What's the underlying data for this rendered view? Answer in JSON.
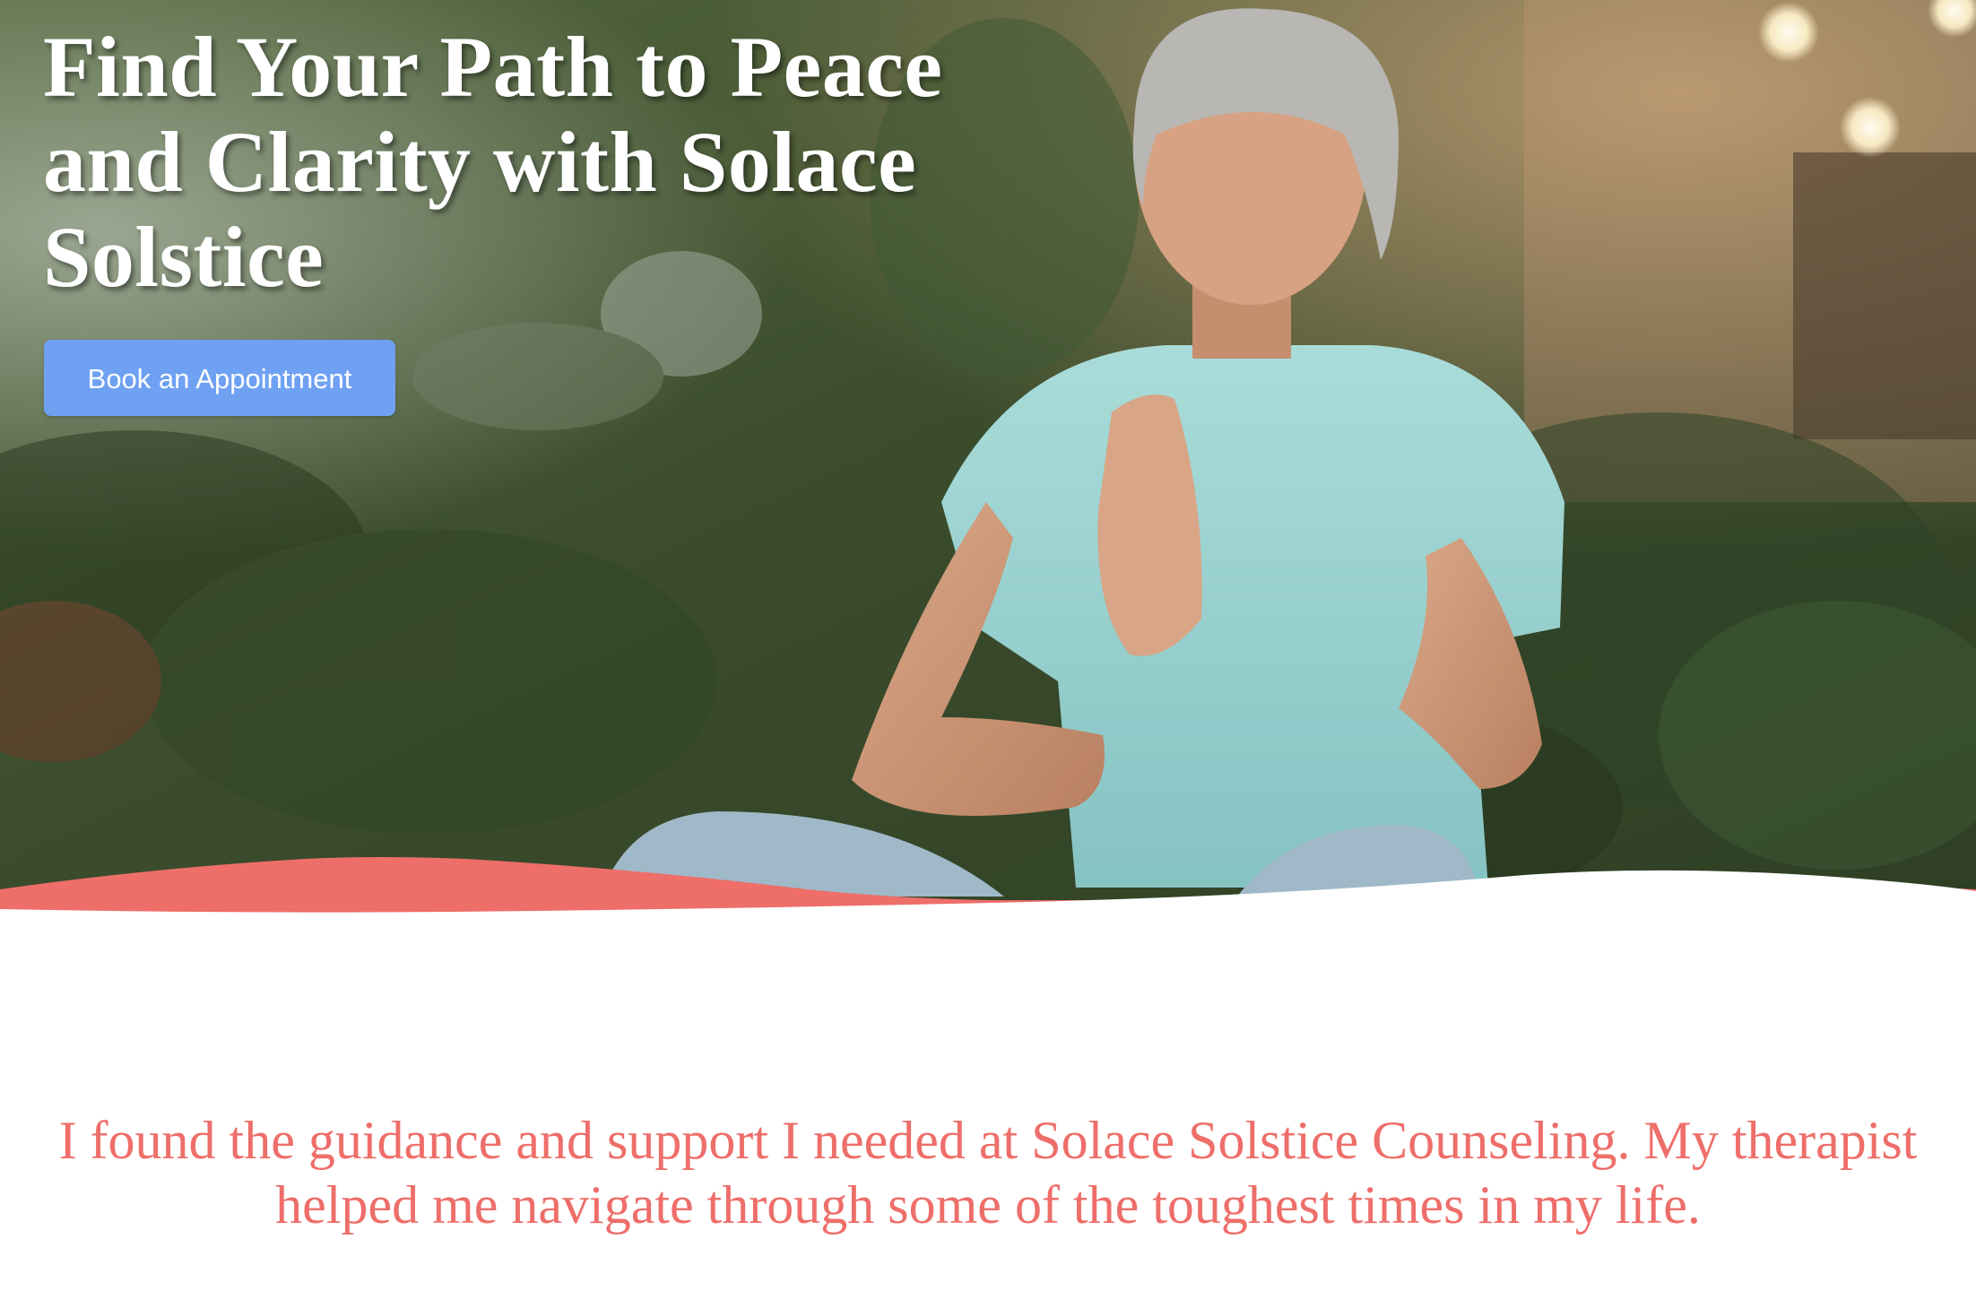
{
  "hero": {
    "title": "Find Your Path to Peace and Clarity with Solace Solstice",
    "cta_label": "Book an Appointment",
    "image_subject": "woman-meditating-in-garden"
  },
  "testimonial": {
    "quote": "I found the guidance and support I needed at Solace Solstice Counseling. My therapist helped me navigate through some of the toughest times in my life."
  },
  "colors": {
    "cta_blue": "#6fa1f2",
    "accent_coral": "#ee6e6a",
    "hero_title_white": "#ffffff",
    "background": "#ffffff"
  }
}
